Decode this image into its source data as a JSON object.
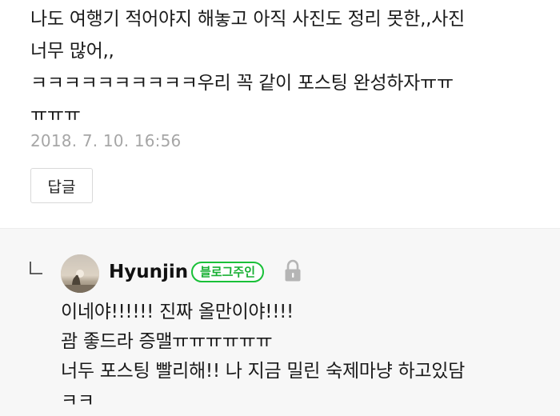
{
  "comment": {
    "text": "나도 여행기 적어야지 해놓고 아직 사진도 정리 못한,,사진\n너무 많어,,\nㅋㅋㅋㅋㅋㅋㅋㅋㅋㅋ우리 꼭 같이 포스팅 완성하자ㅠㅠ\nㅠㅠㅠ",
    "timestamp": "2018. 7. 10. 16:56",
    "reply_button_label": "답글"
  },
  "reply": {
    "arrow_icon": "reply-arrow-icon",
    "author": "Hyunjin",
    "badge_label": "블로그주인",
    "badge_color": "#19c038",
    "lock_icon": "lock-icon",
    "text": "이네야!!!!!! 진짜 올만이야!!!!\n괌 좋드라 증맬ㅠㅠㅠㅠㅠㅠ\n너두 포스팅 빨리해!! 나 지금 밀린 숙제마냥 하고있담\nㅋㅋ"
  },
  "colors": {
    "timestamp": "#a6a6a6",
    "reply_background": "#f7f7f7",
    "badge_green": "#19c038"
  }
}
